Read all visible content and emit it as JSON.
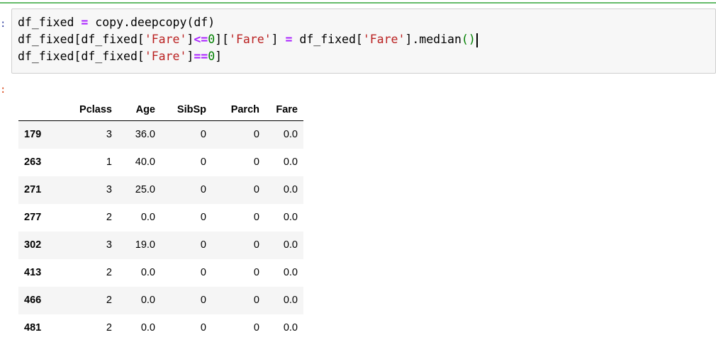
{
  "cell": {
    "in_prompt": ":",
    "out_prompt": ":",
    "code_lines": [
      [
        {
          "t": "df_fixed ",
          "c": ""
        },
        {
          "t": "=",
          "c": "kw-op"
        },
        {
          "t": " copy.deepcopy(df)",
          "c": ""
        }
      ],
      [
        {
          "t": "df_fixed[df_fixed[",
          "c": ""
        },
        {
          "t": "'Fare'",
          "c": "str"
        },
        {
          "t": "]",
          "c": ""
        },
        {
          "t": "<=",
          "c": "kw-op"
        },
        {
          "t": "0",
          "c": "num"
        },
        {
          "t": "][",
          "c": ""
        },
        {
          "t": "'Fare'",
          "c": "str"
        },
        {
          "t": "] ",
          "c": ""
        },
        {
          "t": "=",
          "c": "kw-op"
        },
        {
          "t": " df_fixed[",
          "c": ""
        },
        {
          "t": "'Fare'",
          "c": "str"
        },
        {
          "t": "].median",
          "c": ""
        },
        {
          "t": "()",
          "c": "paren"
        }
      ],
      [
        {
          "t": "df_fixed[df_fixed[",
          "c": ""
        },
        {
          "t": "'Fare'",
          "c": "str"
        },
        {
          "t": "]",
          "c": ""
        },
        {
          "t": "==",
          "c": "kw-op"
        },
        {
          "t": "0",
          "c": "num"
        },
        {
          "t": "]",
          "c": ""
        }
      ]
    ]
  },
  "table": {
    "columns": [
      "Pclass",
      "Age",
      "SibSp",
      "Parch",
      "Fare"
    ],
    "rows": [
      {
        "index": "179",
        "values": [
          "3",
          "36.0",
          "0",
          "0",
          "0.0"
        ]
      },
      {
        "index": "263",
        "values": [
          "1",
          "40.0",
          "0",
          "0",
          "0.0"
        ]
      },
      {
        "index": "271",
        "values": [
          "3",
          "25.0",
          "0",
          "0",
          "0.0"
        ]
      },
      {
        "index": "277",
        "values": [
          "2",
          "0.0",
          "0",
          "0",
          "0.0"
        ]
      },
      {
        "index": "302",
        "values": [
          "3",
          "19.0",
          "0",
          "0",
          "0.0"
        ]
      },
      {
        "index": "413",
        "values": [
          "2",
          "0.0",
          "0",
          "0",
          "0.0"
        ]
      },
      {
        "index": "466",
        "values": [
          "2",
          "0.0",
          "0",
          "0",
          "0.0"
        ]
      },
      {
        "index": "481",
        "values": [
          "2",
          "0.0",
          "0",
          "0",
          "0.0"
        ]
      }
    ]
  },
  "colors": {
    "selected_border": "#66bb6a",
    "input_bg": "#f7f7f7",
    "out_prompt": "#d84315",
    "in_prompt": "#303f9f"
  }
}
